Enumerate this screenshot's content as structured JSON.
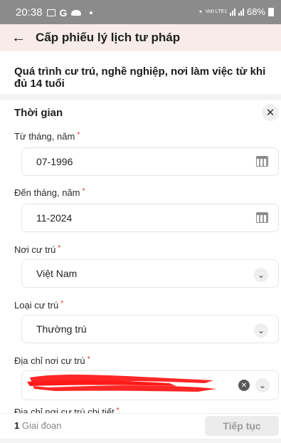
{
  "status_bar": {
    "time": "20:38",
    "g_label": "G",
    "battery": "68%",
    "volte": "Vo0 LTE1"
  },
  "app_bar": {
    "back_icon": "arrow-left-icon",
    "title": "Cấp phiếu lý lịch tư pháp"
  },
  "section": {
    "title": "Quá trình cư trú, nghề nghiệp, nơi làm việc từ khi đủ 14 tuổi"
  },
  "card": {
    "title": "Thời gian",
    "close_icon": "close-icon",
    "fields": [
      {
        "label": "Từ tháng, năm",
        "required": "*",
        "value": "07-1996",
        "icon": "calendar-icon"
      },
      {
        "label": "Đến tháng, năm",
        "required": "*",
        "value": "11-2024",
        "icon": "calendar-icon"
      },
      {
        "label": "Nơi cư trú",
        "required": "*",
        "value": "Việt Nam",
        "icon": "chevron-down-icon"
      },
      {
        "label": "Loại cư trú",
        "required": "*",
        "value": "Thường trú",
        "icon": "chevron-down-icon"
      },
      {
        "label": "Địa chỉ nơi cư trú",
        "required": "*",
        "value": "",
        "icon": "chevron-down-icon"
      }
    ],
    "partial_label": "Địa chỉ nơi cư trú chi tiết"
  },
  "footer": {
    "stage_count": "1",
    "stage_label": "Giai đoạn",
    "next_label": "Tiếp tục"
  },
  "colors": {
    "app_bar_bg": "#f7ece9",
    "required": "#d62020",
    "redaction": "#ff1a1a"
  }
}
